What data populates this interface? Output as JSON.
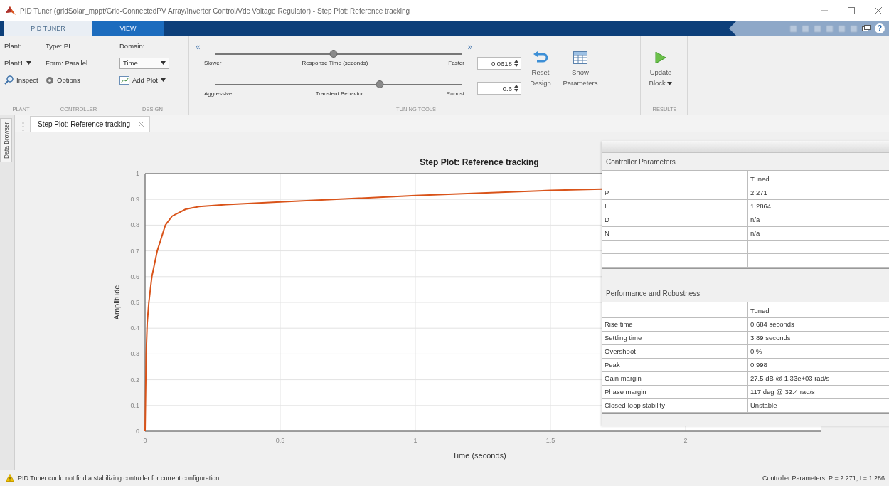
{
  "window": {
    "title": "PID Tuner (gridSolar_mppt/Grid-ConnectedPV Array/Inverter Control/Vdc Voltage Regulator) - Step Plot: Reference tracking"
  },
  "ribbon_tabs": [
    {
      "label": "PID TUNER",
      "selected": true
    },
    {
      "label": "VIEW",
      "selected": false
    }
  ],
  "help_button": "?",
  "ribbon": {
    "plant_group": {
      "label": "Plant:",
      "plant_dropdown": "Plant1",
      "inspect_button": "Inspect",
      "caption": "PLANT"
    },
    "controller_group": {
      "type": "Type: PI",
      "form": "Form: Parallel",
      "options_button": "Options",
      "caption": "CONTROLLER"
    },
    "design_group": {
      "label": "Domain:",
      "domain_select": "Time",
      "add_plot_button": "Add Plot",
      "caption": "DESIGN"
    },
    "tuning_tools_group": {
      "collapse_button": "«",
      "expand_button": "»",
      "sliders": [
        {
          "left_label": "Slower",
          "center_label": "Response Time (seconds)",
          "right_label": "Faster",
          "level": 0.48,
          "value": "0.0618"
        },
        {
          "left_label": "Aggressive",
          "center_label": "Transient Behavior",
          "right_label": "Robust",
          "level": 0.67,
          "value": "0.6"
        }
      ],
      "reset_button": "Reset Design",
      "show_parameters_button": "Show Parameters",
      "caption": "TUNING TOOLS"
    },
    "results_group": {
      "update_button": "Update Block",
      "caption": "RESULTS"
    }
  },
  "side_panel": {
    "label": "Data Browser"
  },
  "document_tabs": [
    {
      "label": "Step Plot: Reference tracking",
      "selected": true
    }
  ],
  "plot": {
    "chart_data": {
      "type": "line",
      "title": "Step Plot: Reference tracking",
      "xlabel": "Time (seconds)",
      "ylabel": "Amplitude",
      "x": [
        0,
        0.004,
        0.008,
        0.014,
        0.025,
        0.045,
        0.075,
        0.1,
        0.15,
        0.2,
        0.3,
        0.5,
        1,
        1.5,
        1.69
      ],
      "series": [
        {
          "color": "#d95319",
          "values": [
            0,
            0.3,
            0.42,
            0.5,
            0.6,
            0.7,
            0.8,
            0.835,
            0.862,
            0.872,
            0.88,
            0.89,
            0.915,
            0.935,
            0.94
          ]
        }
      ],
      "grid": true,
      "xlim": [
        0,
        2.5
      ],
      "ylim": [
        0,
        1
      ],
      "xticks": [
        0,
        0.5,
        1,
        1.5,
        2
      ],
      "yticks": [
        0,
        0.1,
        0.2,
        0.3,
        0.4,
        0.5,
        0.6,
        0.7,
        0.8,
        0.9,
        1
      ]
    }
  },
  "controller_parameters": {
    "title": "Controller Parameters",
    "column": "Tuned",
    "rows": [
      {
        "name": "P",
        "value": "2.271"
      },
      {
        "name": "I",
        "value": "1.2864"
      },
      {
        "name": "D",
        "value": "n/a"
      },
      {
        "name": "N",
        "value": "n/a"
      }
    ]
  },
  "performance": {
    "title": "Performance and Robustness",
    "column": "Tuned",
    "rows": [
      {
        "name": "Rise time",
        "value": "0.684 seconds"
      },
      {
        "name": "Settling time",
        "value": "3.89 seconds"
      },
      {
        "name": "Overshoot",
        "value": "0 %"
      },
      {
        "name": "Peak",
        "value": "0.998"
      },
      {
        "name": "Gain margin",
        "value": "27.5 dB @ 1.33e+03 rad/s"
      },
      {
        "name": "Phase margin",
        "value": "117 deg @ 32.4 rad/s"
      },
      {
        "name": "Closed-loop stability",
        "value": "Unstable"
      }
    ]
  },
  "status_bar": {
    "message": "PID Tuner could not find a stabilizing controller for current configuration",
    "parameters": "Controller Parameters: P = 2.271, I = 1.286"
  }
}
